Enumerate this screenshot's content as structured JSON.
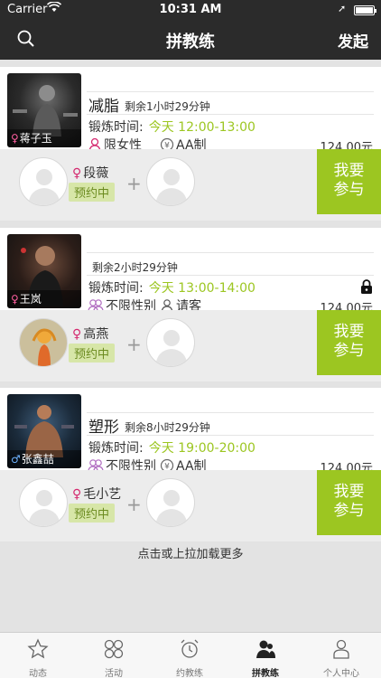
{
  "status_bar": {
    "carrier": "Carrier",
    "time": "10:31 AM"
  },
  "nav": {
    "title": "拼教练",
    "right_action": "发起"
  },
  "cards": [
    {
      "title": "减脂",
      "remaining": "剩余1小时29分钟",
      "time_label": "锻炼时间:",
      "time_value": "今天 12:00-13:00",
      "gender_limit": "限女性",
      "payment": "AA制",
      "price": "124.00元",
      "coach": {
        "name": "蒋子玉",
        "gender": "female"
      },
      "member": {
        "name": "段薇",
        "status": "预约中",
        "gender": "female"
      },
      "join_label": "我要参与",
      "locked": false
    },
    {
      "title": "",
      "remaining": "剩余2小时29分钟",
      "time_label": "锻炼时间:",
      "time_value": "今天 13:00-14:00",
      "gender_limit": "不限性别",
      "payment": "请客",
      "price": "124.00元",
      "coach": {
        "name": "王岚",
        "gender": "female"
      },
      "member": {
        "name": "高燕",
        "status": "预约中",
        "gender": "female"
      },
      "join_label": "我要参与",
      "locked": true
    },
    {
      "title": "塑形",
      "remaining": "剩余8小时29分钟",
      "time_label": "锻炼时间:",
      "time_value": "今天 19:00-20:00",
      "gender_limit": "不限性别",
      "payment": "AA制",
      "price": "124.00元",
      "coach": {
        "name": "张鑫喆",
        "gender": "male"
      },
      "member": {
        "name": "毛小艺",
        "status": "预约中",
        "gender": "female"
      },
      "join_label": "我要参与",
      "locked": false
    }
  ],
  "load_more": "点击或上拉加载更多",
  "tabs": [
    {
      "label": "动态",
      "icon": "star-icon",
      "active": false
    },
    {
      "label": "活动",
      "icon": "activity-icon",
      "active": false
    },
    {
      "label": "约教练",
      "icon": "alarm-clock-icon",
      "active": false
    },
    {
      "label": "拼教练",
      "icon": "group-coach-icon",
      "active": true
    },
    {
      "label": "个人中心",
      "icon": "person-icon",
      "active": false
    }
  ],
  "colors": {
    "accent": "#9cc621",
    "nav_bg": "#2b2b2b",
    "female": "#d4296f",
    "male": "#3a7fd5"
  }
}
